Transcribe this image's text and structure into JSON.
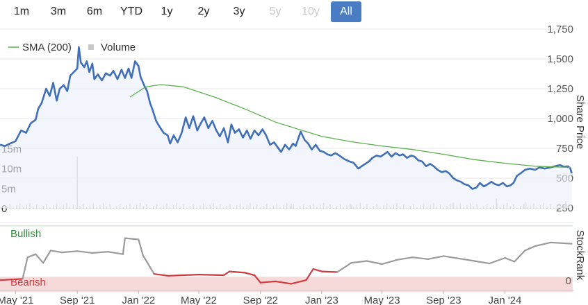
{
  "range_buttons": [
    {
      "label": "1m",
      "state": "normal"
    },
    {
      "label": "3m",
      "state": "normal"
    },
    {
      "label": "6m",
      "state": "normal"
    },
    {
      "label": "YTD",
      "state": "normal"
    },
    {
      "label": "1y",
      "state": "normal"
    },
    {
      "label": "2y",
      "state": "normal"
    },
    {
      "label": "3y",
      "state": "normal"
    },
    {
      "label": "5y",
      "state": "disabled"
    },
    {
      "label": "10y",
      "state": "disabled"
    },
    {
      "label": "All",
      "state": "active"
    }
  ],
  "colors": {
    "price": "#3f6fb8",
    "sma": "#5ab04a",
    "volume": "#c8c8c8",
    "active_button": "#4a7cc4",
    "bullish_band": "#d7ecd9",
    "bearish_band": "#f6d9d9",
    "bullish_text": "#2e8b3a",
    "bearish_text": "#d2383f",
    "rank_neutral": "#9a9a9a",
    "rank_bearish": "#d2383f"
  },
  "chart_data": [
    {
      "type": "line",
      "panel": "price",
      "legend": [
        "SMA (200)",
        "Volume"
      ],
      "x_tick_labels": [
        "May '21",
        "Sep '21",
        "Jan '22",
        "May '22",
        "Sep '22",
        "Jan '23",
        "May '23",
        "Sep '23",
        "Jan '24"
      ],
      "x_tick_dates": [
        "2021-05-01",
        "2021-09-01",
        "2022-01-01",
        "2022-05-01",
        "2022-09-01",
        "2023-01-01",
        "2023-05-01",
        "2023-09-01",
        "2024-01-01"
      ],
      "x_range": [
        "2021-03-31",
        "2024-05-15"
      ],
      "y_right_label": "Share Price",
      "y_right_ticks": [
        "1,750",
        "1,500",
        "1,250",
        "1,000",
        "750",
        "500",
        "250"
      ],
      "y_right_range": [
        250,
        1750
      ],
      "y_left_ticks": [
        "15m",
        "10m",
        "5m",
        "0"
      ],
      "y_left_range": [
        0,
        20
      ],
      "series": [
        {
          "name": "SMA (200)",
          "points": [
            [
              "2021-12-15",
              1180
            ],
            [
              "2022-01-15",
              1265
            ],
            [
              "2022-02-15",
              1285
            ],
            [
              "2022-04-01",
              1265
            ],
            [
              "2022-06-01",
              1180
            ],
            [
              "2022-08-01",
              1080
            ],
            [
              "2022-10-01",
              970
            ],
            [
              "2022-12-01",
              890
            ],
            [
              "2023-01-01",
              850
            ],
            [
              "2023-03-01",
              805
            ],
            [
              "2023-05-01",
              770
            ],
            [
              "2023-07-01",
              740
            ],
            [
              "2023-09-01",
              700
            ],
            [
              "2023-11-01",
              655
            ],
            [
              "2024-01-01",
              625
            ],
            [
              "2024-03-01",
              600
            ],
            [
              "2024-05-10",
              590
            ]
          ]
        },
        {
          "name": "",
          "points": [
            [
              "2021-03-31",
              780
            ],
            [
              "2021-04-10",
              770
            ],
            [
              "2021-04-20",
              790
            ],
            [
              "2021-05-01",
              810
            ],
            [
              "2021-05-12",
              900
            ],
            [
              "2021-05-22",
              880
            ],
            [
              "2021-05-31",
              960
            ],
            [
              "2021-06-10",
              990
            ],
            [
              "2021-06-15",
              1080
            ],
            [
              "2021-06-22",
              1130
            ],
            [
              "2021-07-01",
              1250
            ],
            [
              "2021-07-08",
              1190
            ],
            [
              "2021-07-15",
              1300
            ],
            [
              "2021-07-22",
              1150
            ],
            [
              "2021-07-28",
              1250
            ],
            [
              "2021-08-05",
              1280
            ],
            [
              "2021-08-12",
              1230
            ],
            [
              "2021-08-18",
              1360
            ],
            [
              "2021-08-25",
              1390
            ],
            [
              "2021-09-01",
              1420
            ],
            [
              "2021-09-04",
              1600
            ],
            [
              "2021-09-08",
              1470
            ],
            [
              "2021-09-15",
              1430
            ],
            [
              "2021-09-20",
              1480
            ],
            [
              "2021-09-25",
              1390
            ],
            [
              "2021-10-01",
              1460
            ],
            [
              "2021-10-05",
              1330
            ],
            [
              "2021-10-12",
              1370
            ],
            [
              "2021-10-20",
              1320
            ],
            [
              "2021-10-28",
              1380
            ],
            [
              "2021-11-05",
              1360
            ],
            [
              "2021-11-12",
              1400
            ],
            [
              "2021-11-20",
              1330
            ],
            [
              "2021-11-28",
              1410
            ],
            [
              "2021-12-05",
              1340
            ],
            [
              "2021-12-12",
              1420
            ],
            [
              "2021-12-18",
              1340
            ],
            [
              "2021-12-25",
              1480
            ],
            [
              "2022-01-01",
              1440
            ],
            [
              "2022-01-05",
              1350
            ],
            [
              "2022-01-12",
              1280
            ],
            [
              "2022-01-18",
              1230
            ],
            [
              "2022-01-24",
              1130
            ],
            [
              "2022-01-30",
              1060
            ],
            [
              "2022-02-05",
              980
            ],
            [
              "2022-02-12",
              930
            ],
            [
              "2022-02-20",
              880
            ],
            [
              "2022-02-28",
              860
            ],
            [
              "2022-03-05",
              790
            ],
            [
              "2022-03-12",
              860
            ],
            [
              "2022-03-20",
              800
            ],
            [
              "2022-03-28",
              880
            ],
            [
              "2022-04-05",
              1010
            ],
            [
              "2022-04-12",
              920
            ],
            [
              "2022-04-20",
              1020
            ],
            [
              "2022-04-28",
              900
            ],
            [
              "2022-05-05",
              960
            ],
            [
              "2022-05-12",
              1010
            ],
            [
              "2022-05-20",
              920
            ],
            [
              "2022-05-28",
              980
            ],
            [
              "2022-06-05",
              900
            ],
            [
              "2022-06-12",
              850
            ],
            [
              "2022-06-20",
              920
            ],
            [
              "2022-06-28",
              800
            ],
            [
              "2022-07-05",
              950
            ],
            [
              "2022-07-12",
              880
            ],
            [
              "2022-07-20",
              910
            ],
            [
              "2022-07-28",
              840
            ],
            [
              "2022-08-05",
              900
            ],
            [
              "2022-08-12",
              830
            ],
            [
              "2022-08-20",
              900
            ],
            [
              "2022-08-28",
              860
            ],
            [
              "2022-09-05",
              910
            ],
            [
              "2022-09-12",
              860
            ],
            [
              "2022-09-20",
              780
            ],
            [
              "2022-09-28",
              800
            ],
            [
              "2022-10-05",
              760
            ],
            [
              "2022-10-12",
              720
            ],
            [
              "2022-10-20",
              780
            ],
            [
              "2022-10-28",
              740
            ],
            [
              "2022-11-05",
              790
            ],
            [
              "2022-11-10",
              770
            ],
            [
              "2022-11-20",
              890
            ],
            [
              "2022-11-28",
              820
            ],
            [
              "2022-12-05",
              790
            ],
            [
              "2022-12-12",
              740
            ],
            [
              "2022-12-20",
              780
            ],
            [
              "2022-12-28",
              730
            ],
            [
              "2023-01-05",
              720
            ],
            [
              "2023-01-12",
              700
            ],
            [
              "2023-01-20",
              690
            ],
            [
              "2023-01-28",
              710
            ],
            [
              "2023-02-05",
              690
            ],
            [
              "2023-02-15",
              660
            ],
            [
              "2023-02-25",
              640
            ],
            [
              "2023-03-05",
              630
            ],
            [
              "2023-03-15",
              580
            ],
            [
              "2023-03-25",
              610
            ],
            [
              "2023-04-05",
              640
            ],
            [
              "2023-04-12",
              670
            ],
            [
              "2023-04-20",
              690
            ],
            [
              "2023-04-28",
              680
            ],
            [
              "2023-05-05",
              700
            ],
            [
              "2023-05-12",
              720
            ],
            [
              "2023-05-20",
              680
            ],
            [
              "2023-05-28",
              710
            ],
            [
              "2023-06-05",
              690
            ],
            [
              "2023-06-12",
              700
            ],
            [
              "2023-06-20",
              670
            ],
            [
              "2023-06-28",
              690
            ],
            [
              "2023-07-05",
              680
            ],
            [
              "2023-07-12",
              650
            ],
            [
              "2023-07-20",
              640
            ],
            [
              "2023-07-28",
              600
            ],
            [
              "2023-08-05",
              620
            ],
            [
              "2023-08-12",
              600
            ],
            [
              "2023-08-20",
              570
            ],
            [
              "2023-08-28",
              550
            ],
            [
              "2023-09-05",
              560
            ],
            [
              "2023-09-12",
              540
            ],
            [
              "2023-09-20",
              500
            ],
            [
              "2023-09-28",
              480
            ],
            [
              "2023-10-05",
              470
            ],
            [
              "2023-10-12",
              450
            ],
            [
              "2023-10-20",
              440
            ],
            [
              "2023-10-28",
              410
            ],
            [
              "2023-11-05",
              420
            ],
            [
              "2023-11-12",
              460
            ],
            [
              "2023-11-20",
              430
            ],
            [
              "2023-11-28",
              450
            ],
            [
              "2023-12-05",
              470
            ],
            [
              "2023-12-12",
              450
            ],
            [
              "2023-12-20",
              440
            ],
            [
              "2023-12-28",
              460
            ],
            [
              "2024-01-05",
              430
            ],
            [
              "2024-01-12",
              440
            ],
            [
              "2024-01-18",
              460
            ],
            [
              "2024-01-25",
              520
            ],
            [
              "2024-02-01",
              540
            ],
            [
              "2024-02-10",
              570
            ],
            [
              "2024-02-20",
              580
            ],
            [
              "2024-03-01",
              570
            ],
            [
              "2024-03-10",
              590
            ],
            [
              "2024-03-20",
              580
            ],
            [
              "2024-04-01",
              590
            ],
            [
              "2024-04-10",
              600
            ],
            [
              "2024-04-20",
              610
            ],
            [
              "2024-04-28",
              595
            ],
            [
              "2024-05-05",
              600
            ],
            [
              "2024-05-10",
              585
            ],
            [
              "2024-05-13",
              540
            ]
          ]
        },
        {
          "name": "Volume",
          "points": [
            [
              "2021-09-01",
              13
            ],
            [
              "2022-11-01",
              1.2
            ],
            [
              "2023-03-01",
              1.0
            ],
            [
              "2023-09-20",
              1.5
            ],
            [
              "2023-12-15",
              2.5
            ],
            [
              "2024-02-10",
              1.7
            ],
            [
              "2024-05-01",
              1.8
            ]
          ]
        }
      ]
    },
    {
      "type": "line",
      "panel": "stockrank",
      "y_right_label": "StockRank",
      "y_right_ticks": [
        "0"
      ],
      "y_range": [
        0,
        100
      ],
      "bands": [
        {
          "label": "Bullish",
          "from": 70,
          "to": 100
        },
        {
          "label": "Bearish",
          "from": 0,
          "to": 30
        }
      ],
      "series": [
        {
          "name": "",
          "points": [
            [
              "2021-03-31",
              10
            ],
            [
              "2021-05-15",
              12
            ],
            [
              "2021-05-25",
              47
            ],
            [
              "2021-06-10",
              52
            ],
            [
              "2021-06-25",
              38
            ],
            [
              "2021-07-10",
              58
            ],
            [
              "2021-08-01",
              55
            ],
            [
              "2021-09-01",
              57
            ],
            [
              "2021-10-01",
              54
            ],
            [
              "2021-11-01",
              56
            ],
            [
              "2021-12-01",
              52
            ],
            [
              "2021-12-05",
              78
            ],
            [
              "2022-01-01",
              76
            ],
            [
              "2022-01-10",
              50
            ],
            [
              "2022-02-01",
              20
            ],
            [
              "2022-03-01",
              17
            ],
            [
              "2022-05-01",
              19
            ],
            [
              "2022-06-20",
              18
            ],
            [
              "2022-07-01",
              24
            ],
            [
              "2022-08-01",
              22
            ],
            [
              "2022-08-20",
              18
            ],
            [
              "2022-09-01",
              6
            ],
            [
              "2022-10-01",
              8
            ],
            [
              "2022-11-01",
              4
            ],
            [
              "2022-12-01",
              10
            ],
            [
              "2022-12-15",
              28
            ],
            [
              "2023-01-01",
              24
            ],
            [
              "2023-02-01",
              23
            ],
            [
              "2023-03-01",
              38
            ],
            [
              "2023-04-01",
              41
            ],
            [
              "2023-05-01",
              36
            ],
            [
              "2023-06-01",
              43
            ],
            [
              "2023-07-01",
              47
            ],
            [
              "2023-08-01",
              44
            ],
            [
              "2023-09-01",
              49
            ],
            [
              "2023-10-01",
              45
            ],
            [
              "2023-11-01",
              41
            ],
            [
              "2023-12-01",
              37
            ],
            [
              "2024-01-01",
              46
            ],
            [
              "2024-01-20",
              40
            ],
            [
              "2024-02-10",
              58
            ],
            [
              "2024-03-01",
              65
            ],
            [
              "2024-04-01",
              71
            ],
            [
              "2024-05-13",
              69
            ]
          ]
        }
      ]
    }
  ]
}
